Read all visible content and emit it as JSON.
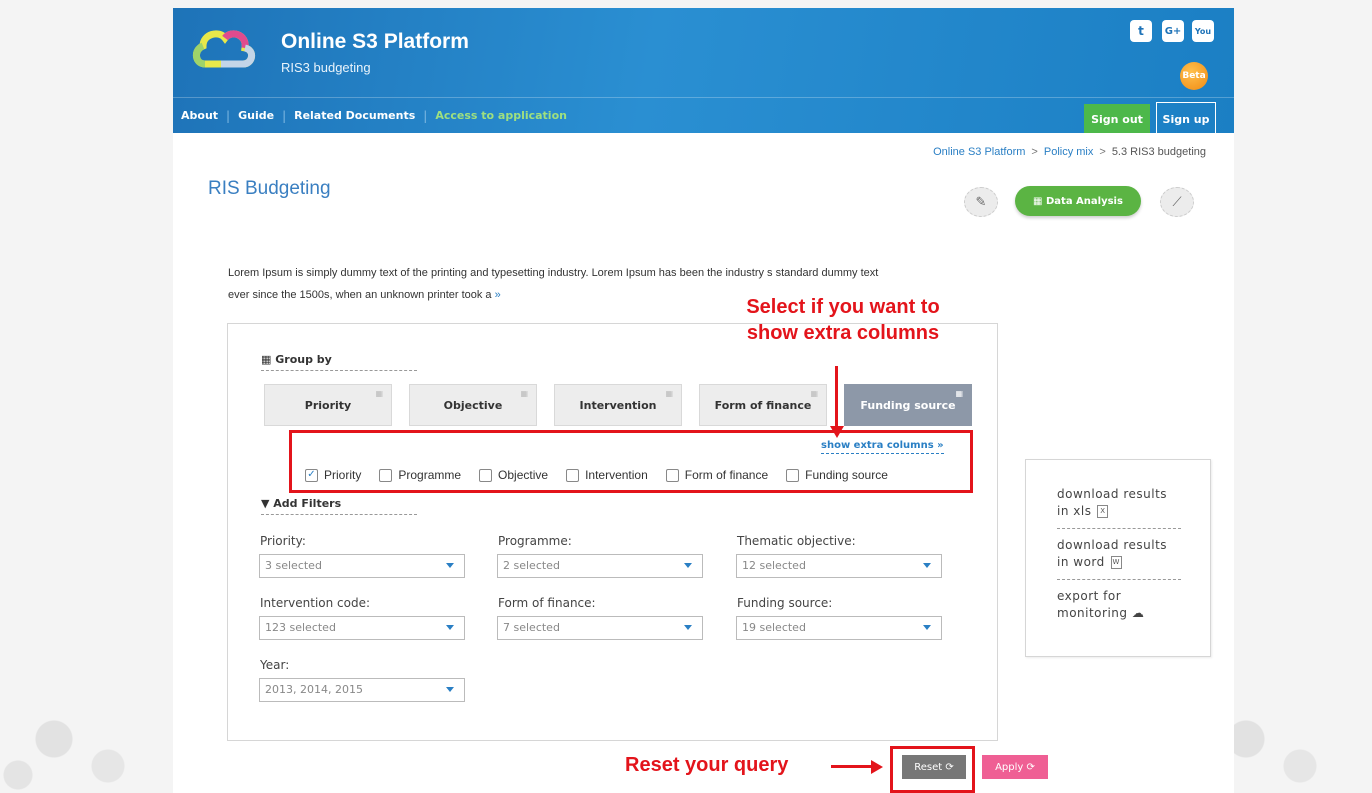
{
  "header": {
    "app_title": "Online S3 Platform",
    "app_subtitle": "RIS3 budgeting",
    "beta_badge": "Beta",
    "social": [
      "twitter-icon",
      "google-plus-icon",
      "youtube-icon"
    ],
    "social_glyphs": [
      "t",
      "G+",
      "You"
    ]
  },
  "nav": {
    "links": [
      "About",
      "Guide",
      "Related Documents",
      "Access to application"
    ],
    "sign_out": "Sign out",
    "sign_up": "Sign up"
  },
  "breadcrumb": [
    "Online S3 Platform",
    "Policy mix",
    "5.3 RIS3 budgeting"
  ],
  "page_title": "RIS Budgeting",
  "toolbar": {
    "data_analysis_label": "Data Analysis"
  },
  "description": {
    "text": "Lorem Ipsum is simply dummy text of the printing and typesetting industry. Lorem Ipsum has been the industry s standard dummy text ever since the 1500s, when an unknown printer took a",
    "more": "»"
  },
  "group_by": {
    "heading": "Group by",
    "buttons": [
      "Priority",
      "Objective",
      "Intervention",
      "Form of finance",
      "Funding source"
    ],
    "active": "Funding source",
    "extra_link": "show extra columns »",
    "extra_columns": [
      {
        "label": "Priority",
        "checked": true
      },
      {
        "label": "Programme",
        "checked": false
      },
      {
        "label": "Objective",
        "checked": false
      },
      {
        "label": "Intervention",
        "checked": false
      },
      {
        "label": "Form of finance",
        "checked": false
      },
      {
        "label": "Funding source",
        "checked": false
      }
    ]
  },
  "filters": {
    "heading": "Add Filters",
    "fields": [
      {
        "label": "Priority:",
        "value": "3 selected"
      },
      {
        "label": "Programme:",
        "value": "2 selected"
      },
      {
        "label": "Thematic objective:",
        "value": "12 selected"
      },
      {
        "label": "Intervention code:",
        "value": "123 selected"
      },
      {
        "label": "Form of finance:",
        "value": "7 selected"
      },
      {
        "label": "Funding source:",
        "value": "19 selected"
      },
      {
        "label": "Year:",
        "value": "2013, 2014, 2015"
      }
    ]
  },
  "side_panel": {
    "download_xls": "download results in xls",
    "download_word": "download results in word",
    "export": "export for monitoring"
  },
  "actions": {
    "reset": "Reset",
    "apply": "Apply",
    "refresh_glyph": "⟳"
  },
  "annotations": {
    "extra_columns_hint_line1": "Select if you want to",
    "extra_columns_hint_line2": "show extra columns",
    "reset_hint": "Reset your query"
  },
  "colors": {
    "header_blue": "#1e73b8",
    "accent_green": "#5bb443",
    "link_blue": "#2a7fc4",
    "apply_pink": "#ef5f94",
    "annotation_red": "#e3141b"
  }
}
